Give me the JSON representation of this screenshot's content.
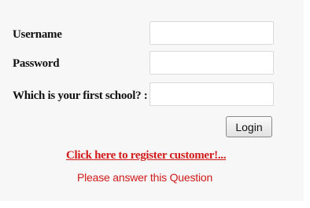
{
  "form": {
    "username": {
      "label": "Username",
      "value": ""
    },
    "password": {
      "label": "Password",
      "value": ""
    },
    "security_question": {
      "label": "Which is your first school? :",
      "value": ""
    },
    "login_label": "Login"
  },
  "register_link": "Click here to register customer!...",
  "validation_message": "Please answer this Question",
  "colors": {
    "panel_background": "#f7f7f7",
    "link": "#d11a1a",
    "message": "#d11a1a",
    "label": "#111111"
  }
}
